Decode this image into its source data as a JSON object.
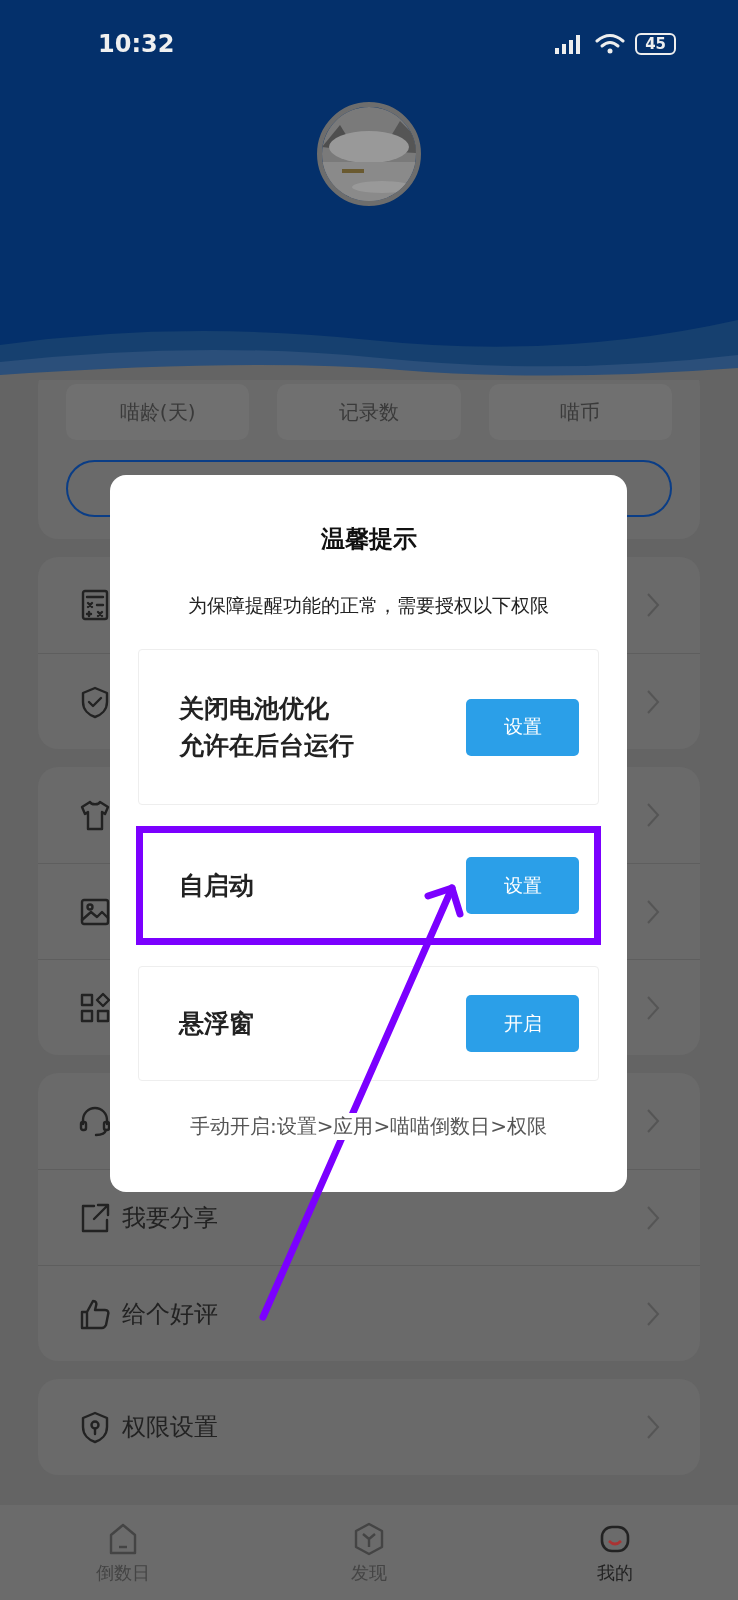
{
  "status_bar": {
    "time": "10:32",
    "battery": "45"
  },
  "stats": [
    "喵龄(天)",
    "记录数",
    "喵币"
  ],
  "menu_groups": [
    {
      "items": [
        {
          "chevron": true
        },
        {
          "chevron": true
        }
      ]
    },
    {
      "items": [
        {
          "chevron": true
        },
        {
          "chevron": true
        },
        {
          "chevron": true
        }
      ]
    },
    {
      "items": [
        {
          "chevron": true
        },
        {
          "label": "我要分享",
          "chevron": true
        },
        {
          "label": "给个好评",
          "chevron": true
        }
      ]
    },
    {
      "items": [
        {
          "label": "权限设置",
          "chevron": true
        }
      ]
    }
  ],
  "dialog": {
    "title": "温馨提示",
    "message": "为保障提醒功能的正常，需要授权以下权限",
    "permissions": [
      {
        "lines": [
          "关闭电池优化",
          "允许在后台运行"
        ],
        "button": "设置",
        "highlighted": false
      },
      {
        "lines": [
          "自启动"
        ],
        "button": "设置",
        "highlighted": true
      },
      {
        "lines": [
          "悬浮窗"
        ],
        "button": "开启",
        "highlighted": false
      }
    ],
    "footer": "手动开启:设置>应用>喵喵倒数日>权限"
  },
  "tabs": [
    {
      "label": "倒数日",
      "selected": false
    },
    {
      "label": "发现",
      "selected": false
    },
    {
      "label": "我的",
      "selected": true
    }
  ]
}
